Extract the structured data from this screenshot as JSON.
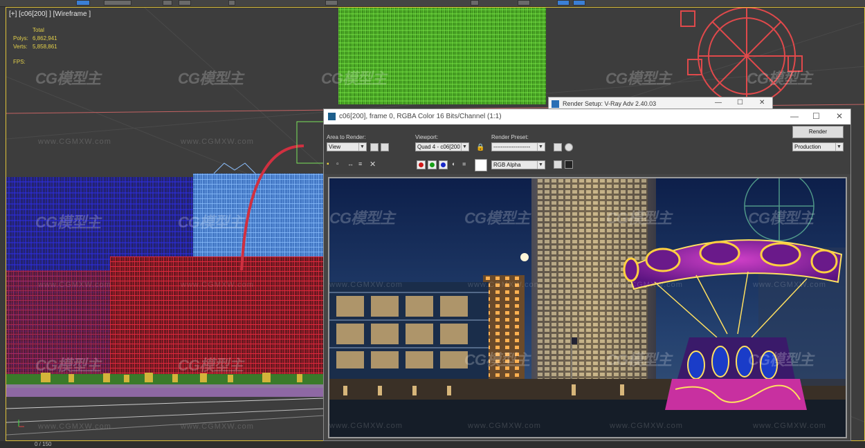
{
  "viewport": {
    "label": "[+] [c06[200] ] [Wireframe ]",
    "stats_header": "Total",
    "polys_label": "Polys:",
    "polys_value": "6,862,941",
    "verts_label": "Verts:",
    "verts_value": "5,858,861",
    "fps_label": "FPS:"
  },
  "timeline": {
    "frame_counter": "0 / 150"
  },
  "watermarks": {
    "logo": "CG模型主",
    "url": "www.CGMXW.com"
  },
  "render_setup": {
    "title": "Render Setup: V-Ray Adv 2.40.03"
  },
  "frame_buffer": {
    "title": "c06[200], frame 0, RGBA Color 16 Bits/Channel (1:1)",
    "area_label": "Area to Render:",
    "area_value": "View",
    "viewport_label": "Viewport:",
    "viewport_value": "Quad 4 - c06[200",
    "preset_label": "Render Preset:",
    "preset_value": "--------------------",
    "render_button": "Render",
    "mode_value": "Production",
    "channel_value": "RGB Alpha"
  },
  "colors": {
    "active_border": "#e0c23a",
    "wire_green": "#5bd12a",
    "wire_red": "#e23b3b",
    "wire_blue": "#2b2bd6",
    "wire_lightblue": "#5f9dea",
    "accent": "#3b7fd6"
  },
  "icons": [
    "select-icon",
    "move-icon",
    "lock-icon",
    "save-image-icon",
    "copy-icon",
    "clear-icon",
    "red-channel-icon",
    "green-channel-icon",
    "blue-channel-icon",
    "mono-icon",
    "color-swatch-icon",
    "minimize-icon",
    "maximize-icon",
    "close-icon"
  ]
}
